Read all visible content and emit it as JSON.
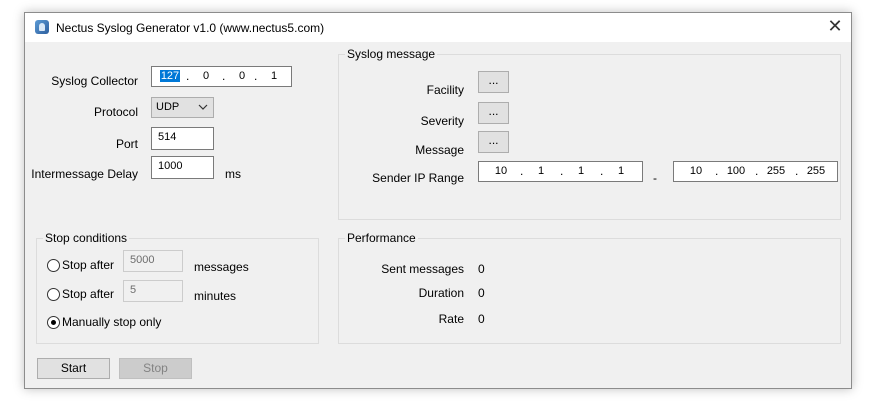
{
  "window": {
    "title": "Nectus Syslog Generator v1.0 (www.nectus5.com)",
    "close_symbol": "✕",
    "icon": "app-icon"
  },
  "collector": {
    "label": "Syslog Collector",
    "ip": [
      "127",
      "0",
      "0",
      "1"
    ]
  },
  "protocol": {
    "label": "Protocol",
    "value": "UDP"
  },
  "port": {
    "label": "Port",
    "value": "514"
  },
  "delay": {
    "label": "Intermessage Delay",
    "value": "1000",
    "unit": "ms"
  },
  "syslog_message": {
    "title": "Syslog message",
    "facility_label": "Facility",
    "severity_label": "Severity",
    "message_label": "Message",
    "browse_label": "...",
    "sender_range_label": "Sender IP Range",
    "range_from": [
      "10",
      "1",
      "1",
      "1"
    ],
    "range_separator": "-",
    "range_to": [
      "10",
      "100",
      "255",
      "255"
    ]
  },
  "stop_conditions": {
    "title": "Stop conditions",
    "option1_label": "Stop after",
    "option1_value": "5000",
    "option1_unit": "messages",
    "option2_label": "Stop after",
    "option2_value": "5",
    "option2_unit": "minutes",
    "option3_label": "Manually stop only",
    "selected": "manual"
  },
  "performance": {
    "title": "Performance",
    "sent_label": "Sent messages",
    "sent_value": "0",
    "duration_label": "Duration",
    "duration_value": "0",
    "rate_label": "Rate",
    "rate_value": "0"
  },
  "buttons": {
    "start": "Start",
    "stop": "Stop"
  },
  "colors": {
    "selection": "#0078d7",
    "window_bg": "#f0f0f0"
  }
}
